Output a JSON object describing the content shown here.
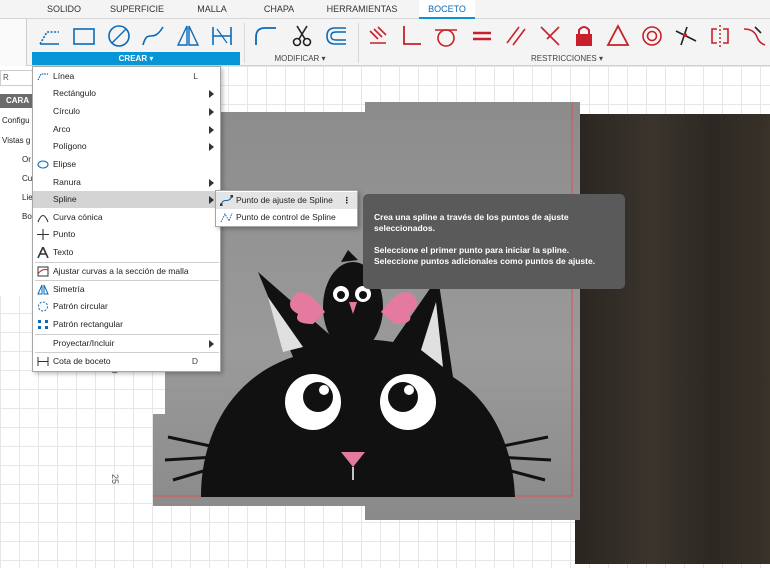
{
  "tabs": [
    "SOLIDO",
    "SUPERFICIE",
    "MALLA",
    "CHAPA",
    "HERRAMIENTAS",
    "BOCETO"
  ],
  "active_tab": "BOCETO",
  "ribbon": {
    "crear_label": "CREAR ▾",
    "modificar_label": "MODIFICAR ▾",
    "restricciones_label": "RESTRICCIONES ▾"
  },
  "browser": {
    "search_placeholder": "R",
    "header": "CARA",
    "rows": [
      "Configu",
      "Vistas g",
      "Or",
      "Cu",
      "Lie",
      "Bo"
    ]
  },
  "menu": {
    "items": [
      {
        "label": "Línea",
        "shortcut": "L"
      },
      {
        "label": "Rectángulo"
      },
      {
        "label": "Círculo"
      },
      {
        "label": "Arco"
      },
      {
        "label": "Polígono"
      },
      {
        "label": "Elipse"
      },
      {
        "label": "Ranura"
      },
      {
        "label": "Spline"
      },
      {
        "label": "Curva cónica"
      },
      {
        "label": "Punto"
      },
      {
        "label": "Texto"
      },
      {
        "label": "Ajustar curvas a la sección de malla"
      },
      {
        "label": "Simetría"
      },
      {
        "label": "Patrón circular"
      },
      {
        "label": "Patrón rectangular"
      },
      {
        "label": "Proyectar/Incluir"
      },
      {
        "label": "Cota de boceto",
        "shortcut": "D"
      }
    ]
  },
  "submenu": {
    "items": [
      {
        "label": "Punto de ajuste de Spline",
        "more": "⋮"
      },
      {
        "label": "Punto de control de Spline"
      }
    ]
  },
  "tooltip": {
    "line1": "Crea una spline a través de los puntos de ajuste seleccionados.",
    "line2": "Seleccione el primer punto para iniciar la spline. Seleccione puntos adicionales como puntos de ajuste."
  },
  "ruler": {
    "label_a": "0",
    "label_b": "25"
  },
  "colors": {
    "accent": "#0696d7",
    "constraint_red": "#c8202a",
    "tooltip_bg": "#5a5a5a"
  }
}
